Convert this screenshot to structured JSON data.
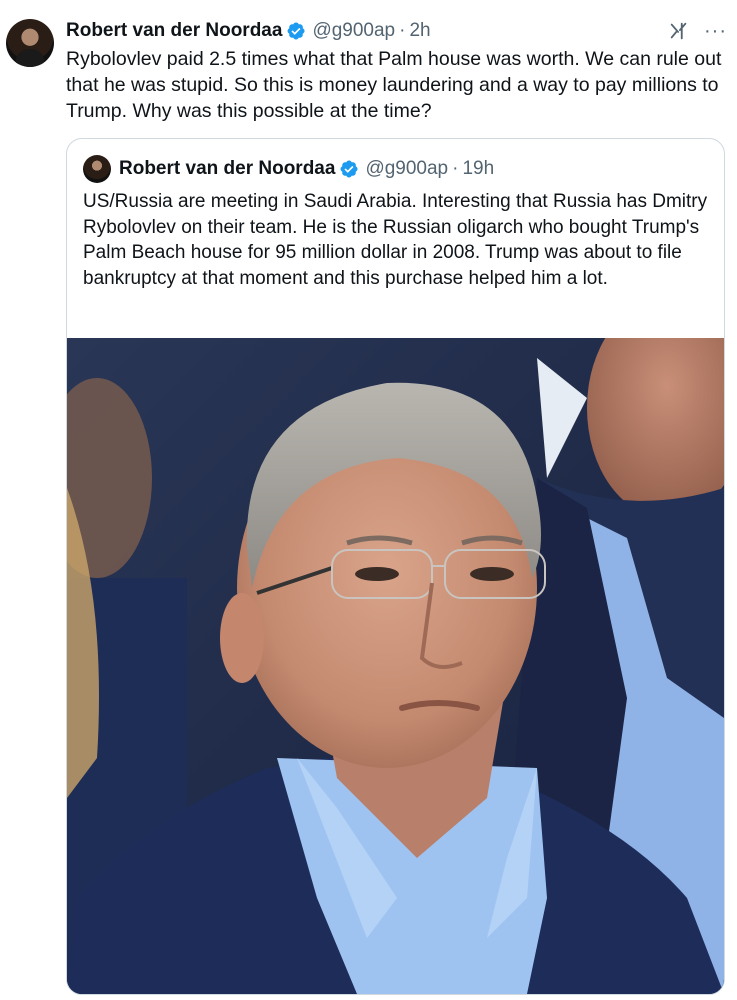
{
  "tweet": {
    "author_name": "Robert van der Noordaa",
    "handle": "@g900ap",
    "separator": "·",
    "time": "2h",
    "text": "Rybolovlev paid 2.5 times what that Palm house was worth. We can rule out that he was stupid. So this is money laundering and a way to pay millions to Trump. Why was this possible at the time?",
    "more_label": "···"
  },
  "quoted": {
    "author_name": "Robert van der Noordaa",
    "handle": "@g900ap",
    "separator": "·",
    "time": "19h",
    "text": "US/Russia are meeting in Saudi Arabia. Interesting that Russia has Dmitry Rybolovlev on their team. He is the Russian oligarch who bought Trump's Palm Beach house for 95 million dollar in 2008. Trump was about to file bankruptcy at that moment and this purchase helped him a lot."
  },
  "colors": {
    "verified": "#1d9bf0",
    "text_primary": "#0f1419",
    "text_muted": "#536471",
    "border": "#cfd9de"
  },
  "icons": [
    "verified-badge-icon",
    "grok-icon",
    "more-icon"
  ]
}
